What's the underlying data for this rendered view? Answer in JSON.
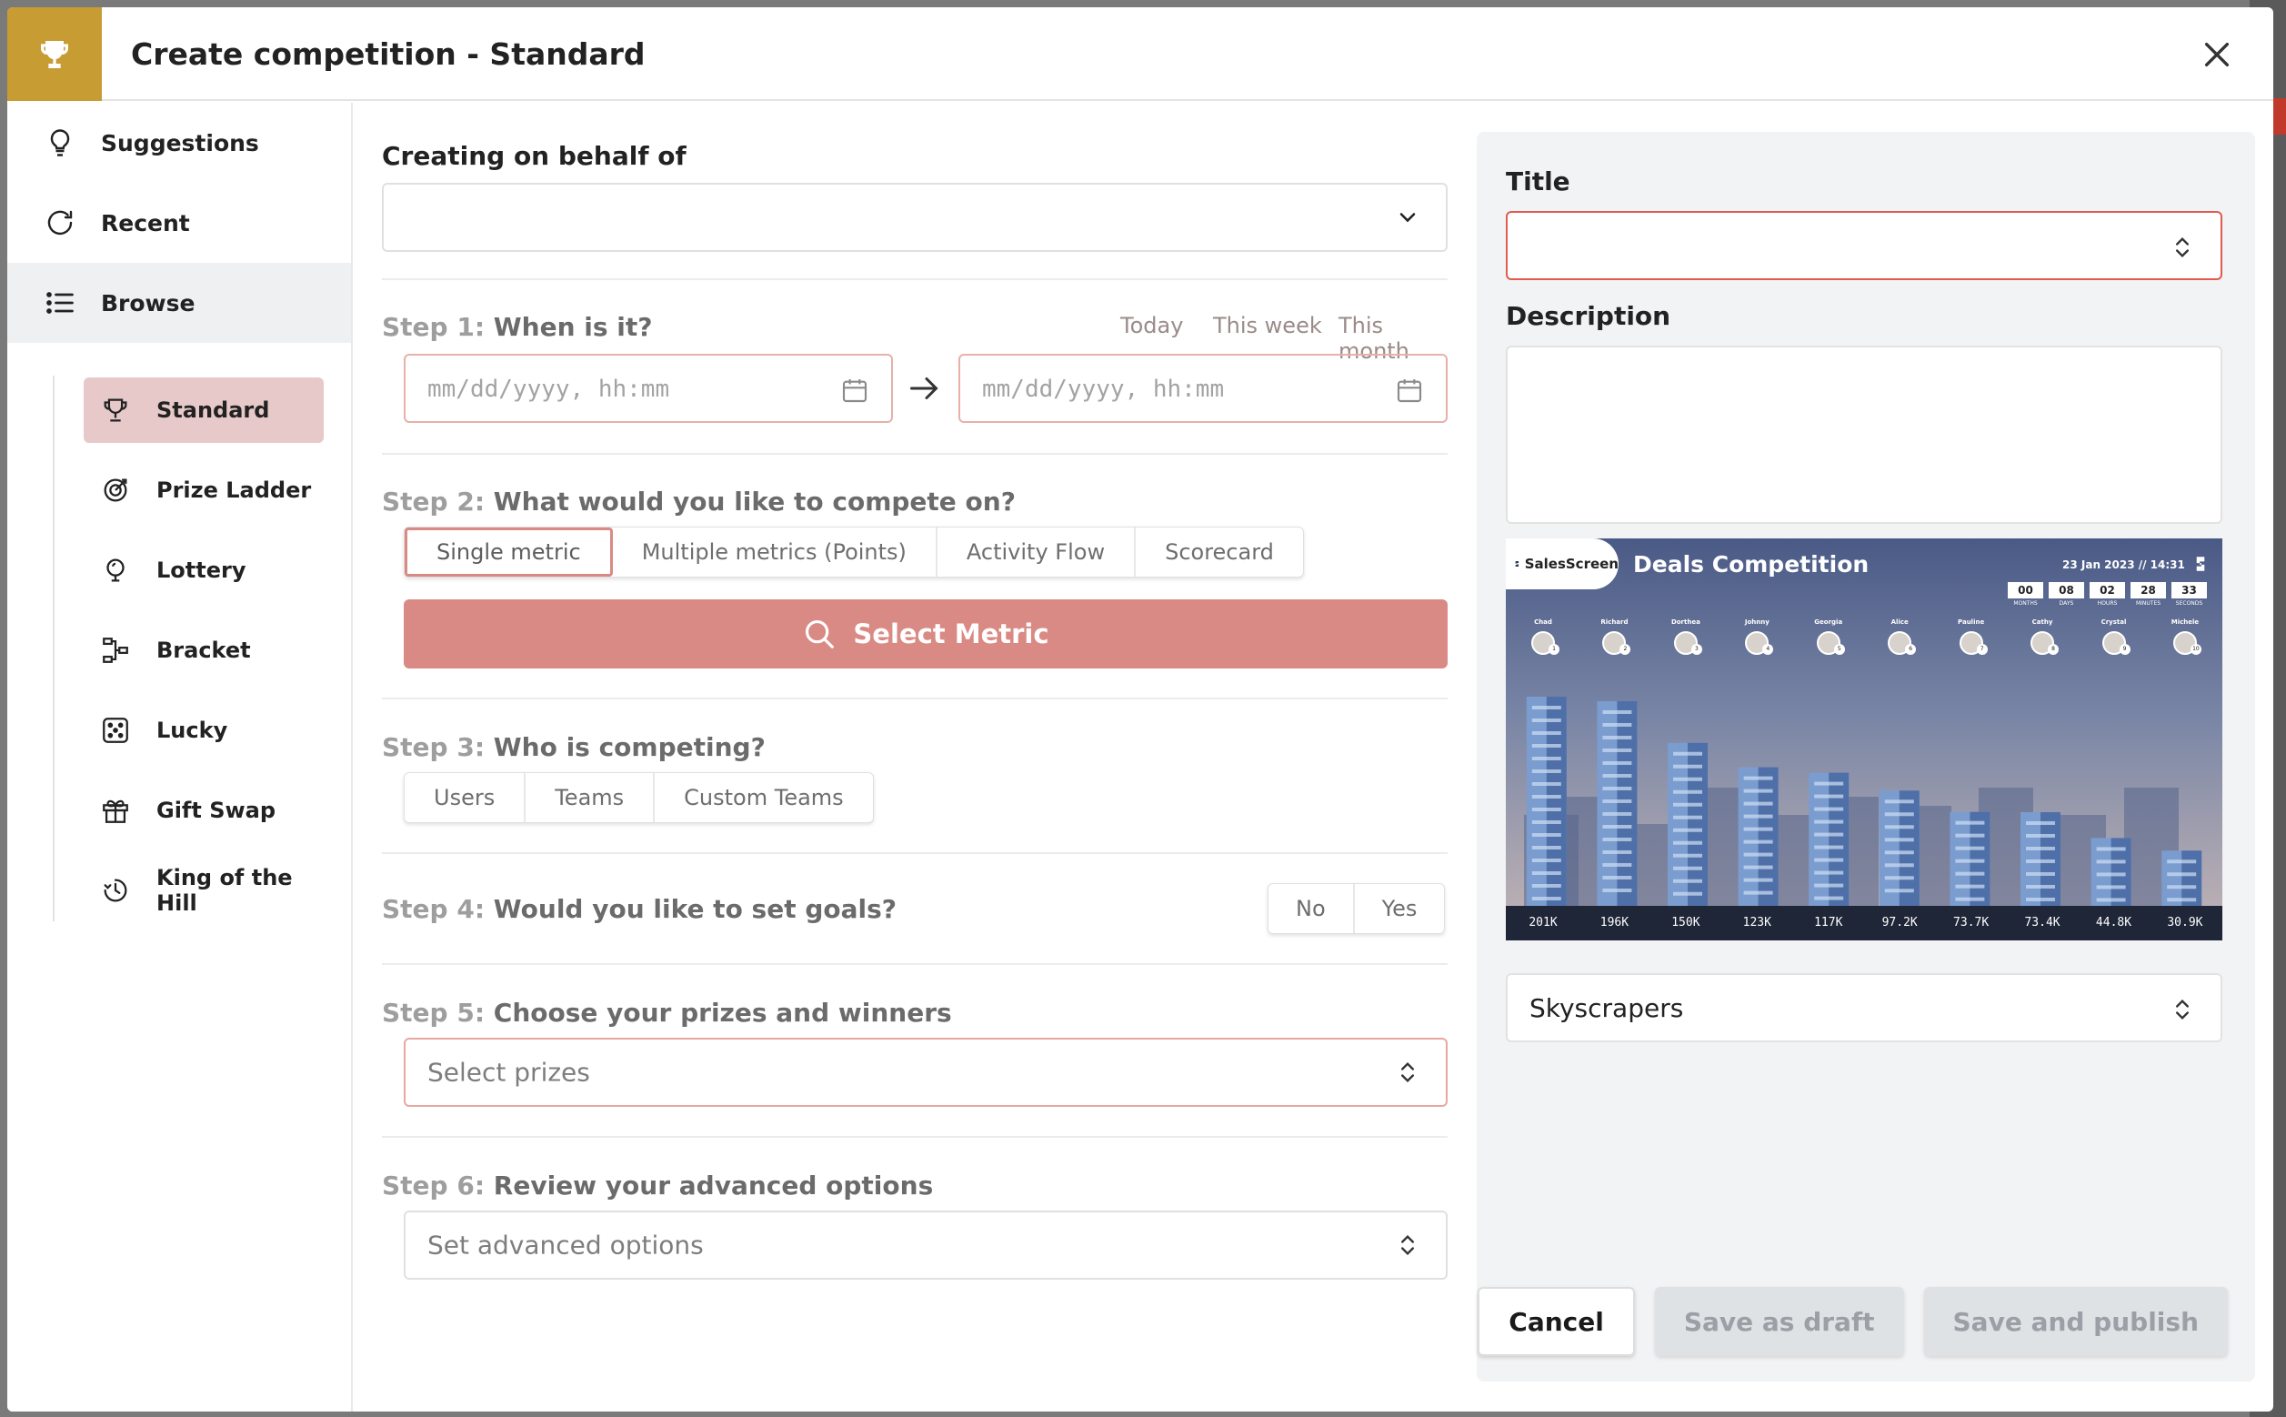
{
  "header": {
    "title": "Create competition - Standard"
  },
  "sidebar": {
    "items": [
      {
        "label": "Suggestions",
        "icon": "lightbulb-icon"
      },
      {
        "label": "Recent",
        "icon": "refresh-icon"
      },
      {
        "label": "Browse",
        "icon": "list-icon"
      }
    ],
    "sub_items": [
      {
        "label": "Standard",
        "icon": "trophy-icon"
      },
      {
        "label": "Prize Ladder",
        "icon": "target-icon"
      },
      {
        "label": "Lottery",
        "icon": "lottery-icon"
      },
      {
        "label": "Bracket",
        "icon": "bracket-icon"
      },
      {
        "label": "Lucky",
        "icon": "dice-icon"
      },
      {
        "label": "Gift Swap",
        "icon": "gift-icon"
      },
      {
        "label": "King of the Hill",
        "icon": "clock-icon"
      }
    ]
  },
  "form": {
    "behalf_label": "Creating on behalf of",
    "step1": {
      "num": "Step 1:",
      "text": "When is it?",
      "quick": [
        "Today",
        "This week",
        "This month"
      ],
      "date_placeholder": "mm/dd/yyyy, hh:mm"
    },
    "step2": {
      "num": "Step 2:",
      "text": "What would you like to compete on?",
      "options": [
        "Single metric",
        "Multiple metrics (Points)",
        "Activity Flow",
        "Scorecard"
      ],
      "button": "Select Metric"
    },
    "step3": {
      "num": "Step 3:",
      "text": "Who is competing?",
      "options": [
        "Users",
        "Teams",
        "Custom Teams"
      ]
    },
    "step4": {
      "num": "Step 4:",
      "text": "Would you like to set goals?",
      "options": [
        "No",
        "Yes"
      ]
    },
    "step5": {
      "num": "Step 5:",
      "text": "Choose your prizes and winners",
      "placeholder": "Select prizes"
    },
    "step6": {
      "num": "Step 6:",
      "text": "Review your advanced options",
      "placeholder": "Set advanced options"
    }
  },
  "right": {
    "title_label": "Title",
    "description_label": "Description",
    "preview": {
      "brand": "SalesScreen",
      "title": "Deals Competition",
      "date": "23 Jan 2023  //  14:31",
      "countdown": [
        {
          "value": "00",
          "unit": "MONTHS"
        },
        {
          "value": "08",
          "unit": "DAYS"
        },
        {
          "value": "02",
          "unit": "HOURS"
        },
        {
          "value": "28",
          "unit": "MINUTES"
        },
        {
          "value": "33",
          "unit": "SECONDS"
        }
      ],
      "players": [
        {
          "name": "Chad",
          "value": "201K",
          "rank": "1"
        },
        {
          "name": "Richard",
          "value": "196K",
          "rank": "2"
        },
        {
          "name": "Dorthea",
          "value": "150K",
          "rank": "3"
        },
        {
          "name": "Johnny",
          "value": "123K",
          "rank": "4"
        },
        {
          "name": "Georgia",
          "value": "117K",
          "rank": "5"
        },
        {
          "name": "Alice",
          "value": "97.2K",
          "rank": "6"
        },
        {
          "name": "Pauline",
          "value": "73.7K",
          "rank": "7"
        },
        {
          "name": "Cathy",
          "value": "73.4K",
          "rank": "8"
        },
        {
          "name": "Crystal",
          "value": "44.8K",
          "rank": "9"
        },
        {
          "name": "Michele",
          "value": "30.9K",
          "rank": "10"
        }
      ]
    },
    "theme_value": "Skyscrapers",
    "buttons": {
      "cancel": "Cancel",
      "draft": "Save as draft",
      "publish": "Save and publish"
    }
  },
  "colors": {
    "accent_gold": "#c79c33",
    "accent_rose": "#d98a84",
    "error_red": "#e35a4e"
  }
}
